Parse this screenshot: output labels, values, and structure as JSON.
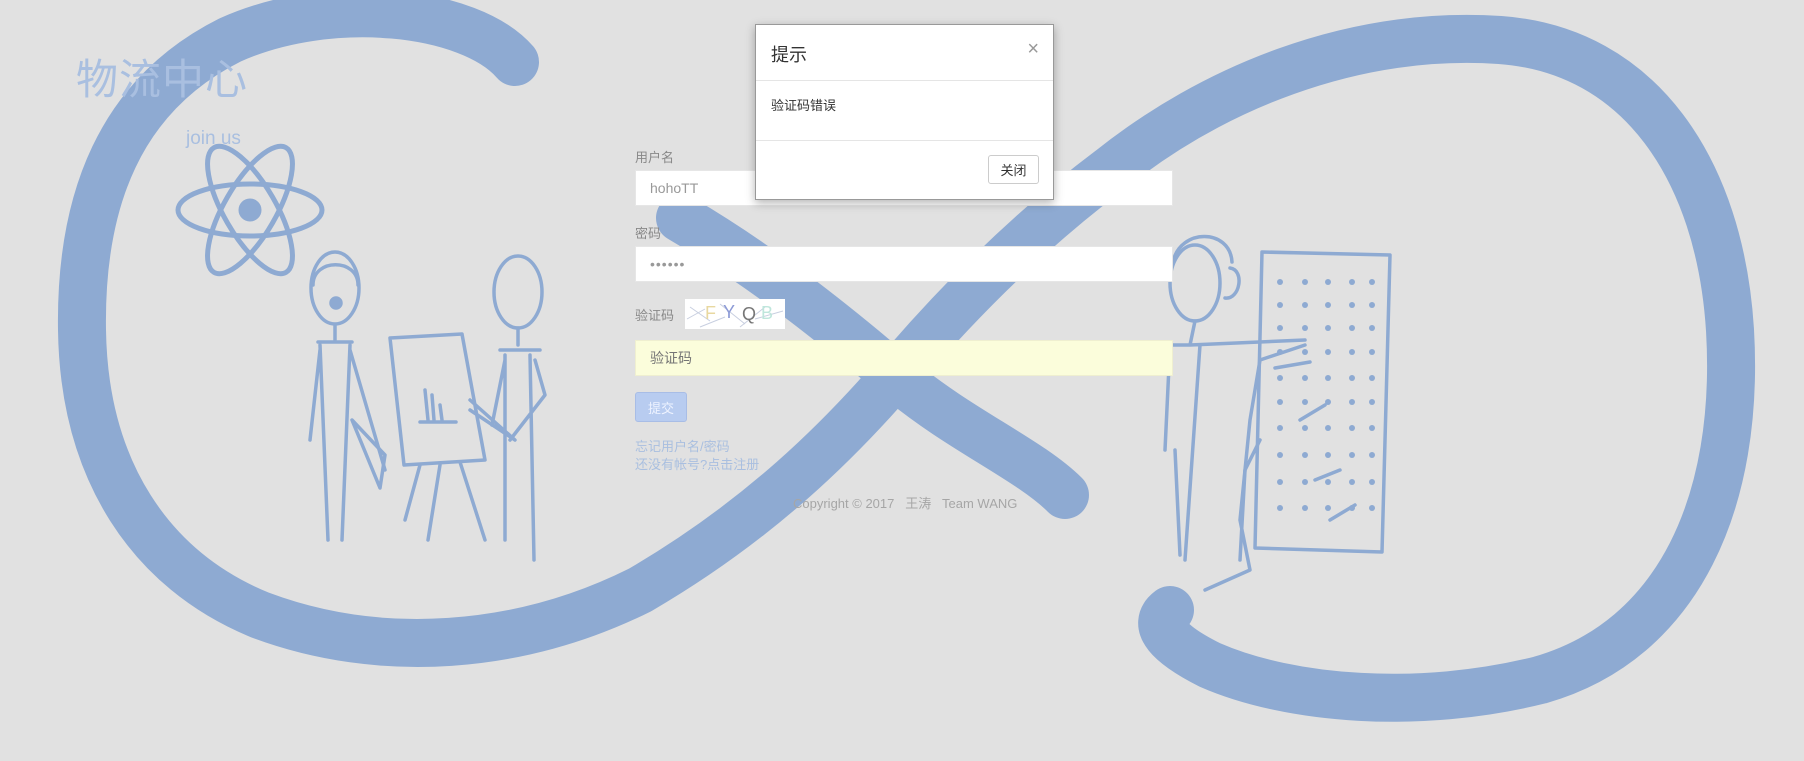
{
  "brand": {
    "title": "物流中心",
    "subtitle": "join  us"
  },
  "form": {
    "username_label": "用户名",
    "username_value": "hohoTT",
    "password_label": "密码",
    "password_value": "••••••",
    "captcha_label": "验证码",
    "captcha_chars": [
      "F",
      "Y",
      "Q",
      "B"
    ],
    "captcha_placeholder": "验证码",
    "submit_label": "提交",
    "forgot_link": "忘记用户名/密码",
    "register_link": "还没有帐号?点击注册"
  },
  "footer": {
    "copyright": "Copyright © 2017   王涛   Team WANG"
  },
  "modal": {
    "title": "提示",
    "close_symbol": "×",
    "message": "验证码错误",
    "close_button": "关闭"
  },
  "colors": {
    "background": "#e1e1e1",
    "doodle_blue": "#8eaad2",
    "link_blue": "#a9bfe0"
  }
}
